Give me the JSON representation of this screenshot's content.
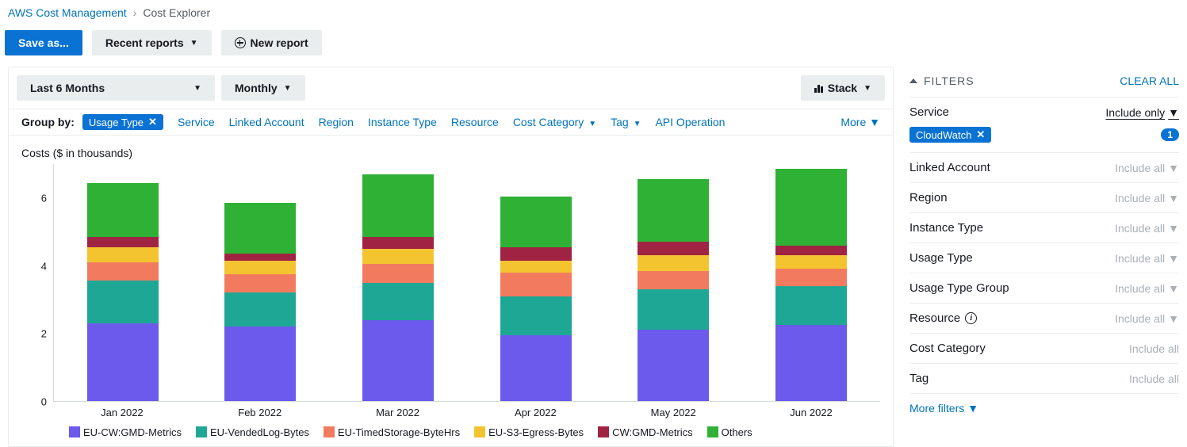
{
  "breadcrumb": {
    "root": "AWS Cost Management",
    "current": "Cost Explorer"
  },
  "toolbar": {
    "save_as": "Save as...",
    "recent_reports": "Recent reports",
    "new_report": "New report"
  },
  "controls": {
    "range": "Last 6 Months",
    "granularity": "Monthly",
    "chart_type": "Stack"
  },
  "groupby": {
    "label": "Group by:",
    "active": "Usage Type",
    "options": [
      "Service",
      "Linked Account",
      "Region",
      "Instance Type",
      "Resource",
      "Cost Category",
      "Tag",
      "API Operation"
    ],
    "more": "More"
  },
  "chart_data": {
    "type": "bar",
    "title": "Costs ($ in thousands)",
    "ylabel": "",
    "xlabel": "",
    "ylim": [
      0,
      7
    ],
    "yticks": [
      0,
      2,
      4,
      6
    ],
    "categories": [
      "Jan 2022",
      "Feb 2022",
      "Mar 2022",
      "Apr 2022",
      "May 2022",
      "Jun 2022"
    ],
    "series": [
      {
        "name": "EU-CW:GMD-Metrics",
        "color": "#6b5aec",
        "values": [
          2.3,
          2.2,
          2.4,
          1.95,
          2.1,
          2.25
        ]
      },
      {
        "name": "EU-VendedLog-Bytes",
        "color": "#1fa796",
        "values": [
          1.25,
          1.0,
          1.1,
          1.15,
          1.2,
          1.15
        ]
      },
      {
        "name": "EU-TimedStorage-ByteHrs",
        "color": "#f27b5f",
        "values": [
          0.55,
          0.55,
          0.55,
          0.7,
          0.55,
          0.5
        ]
      },
      {
        "name": "EU-S3-Egress-Bytes",
        "color": "#f4c430",
        "values": [
          0.45,
          0.4,
          0.45,
          0.35,
          0.45,
          0.4
        ]
      },
      {
        "name": "CW:GMD-Metrics",
        "color": "#a12344",
        "values": [
          0.3,
          0.2,
          0.35,
          0.4,
          0.4,
          0.3
        ]
      },
      {
        "name": "Others",
        "color": "#2eb135",
        "values": [
          1.6,
          1.5,
          1.85,
          1.5,
          1.85,
          2.25
        ]
      }
    ]
  },
  "filters": {
    "heading": "FILTERS",
    "clear": "CLEAR ALL",
    "include_only": "Include only",
    "include_all": "Include all",
    "more_filters": "More filters",
    "service": {
      "label": "Service",
      "chips": [
        "CloudWatch"
      ],
      "count": "1"
    },
    "rows": [
      {
        "name": "Linked Account",
        "value": "Include all",
        "active": false
      },
      {
        "name": "Region",
        "value": "Include all",
        "active": false
      },
      {
        "name": "Instance Type",
        "value": "Include all",
        "active": false
      },
      {
        "name": "Usage Type",
        "value": "Include all",
        "active": false
      },
      {
        "name": "Usage Type Group",
        "value": "Include all",
        "active": false
      },
      {
        "name": "Resource",
        "value": "Include all",
        "active": false,
        "info": true
      },
      {
        "name": "Cost Category",
        "value": "Include all",
        "active": false,
        "nocaret": true
      },
      {
        "name": "Tag",
        "value": "Include all",
        "active": false,
        "nocaret": true
      }
    ]
  }
}
